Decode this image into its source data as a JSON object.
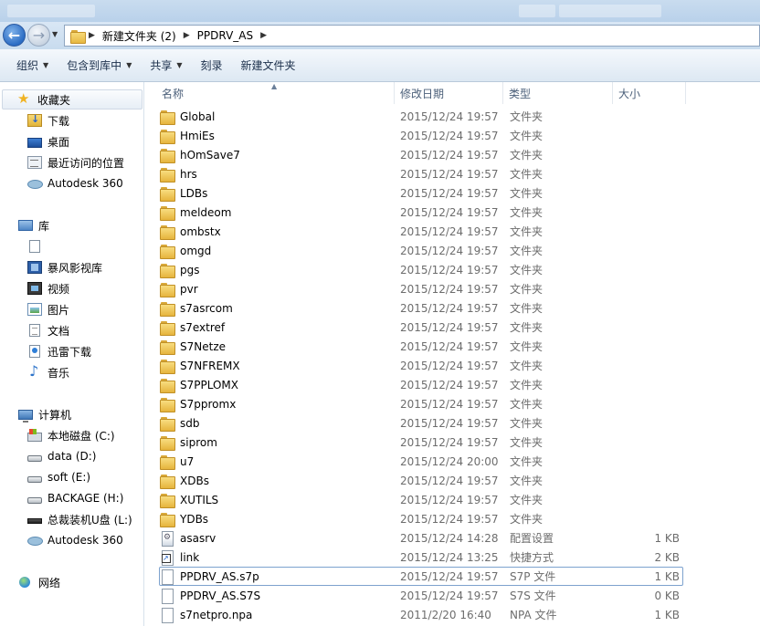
{
  "address": {
    "crumbs": [
      "新建文件夹 (2)",
      "PPDRV_AS"
    ]
  },
  "toolbar": {
    "items": [
      {
        "label": "组织",
        "dropdown": true
      },
      {
        "label": "包含到库中",
        "dropdown": true
      },
      {
        "label": "共享",
        "dropdown": true
      },
      {
        "label": "刻录",
        "dropdown": false
      },
      {
        "label": "新建文件夹",
        "dropdown": false
      }
    ]
  },
  "sidebar": {
    "favorites": {
      "label": "收藏夹",
      "items": [
        {
          "label": "下载",
          "icon": "download-folder-icon"
        },
        {
          "label": "桌面",
          "icon": "desktop-icon"
        },
        {
          "label": "最近访问的位置",
          "icon": "recent-places-icon"
        },
        {
          "label": "Autodesk 360",
          "icon": "autodesk-cloud-icon"
        }
      ]
    },
    "libraries": {
      "label": "库",
      "items": [
        {
          "label": "",
          "icon": "document-icon"
        },
        {
          "label": "暴风影视库",
          "icon": "media-library-icon"
        },
        {
          "label": "视频",
          "icon": "video-icon"
        },
        {
          "label": "图片",
          "icon": "pictures-icon"
        },
        {
          "label": "文档",
          "icon": "documents-icon"
        },
        {
          "label": "迅雷下载",
          "icon": "thunder-download-icon"
        },
        {
          "label": "音乐",
          "icon": "music-icon"
        }
      ]
    },
    "computer": {
      "label": "计算机",
      "items": [
        {
          "label": "本地磁盘 (C:)",
          "icon": "system-drive-icon"
        },
        {
          "label": "data (D:)",
          "icon": "drive-icon"
        },
        {
          "label": "soft (E:)",
          "icon": "drive-icon"
        },
        {
          "label": "BACKAGE (H:)",
          "icon": "drive-icon"
        },
        {
          "label": "总裁装机U盘 (L:)",
          "icon": "usb-drive-icon"
        },
        {
          "label": "Autodesk 360",
          "icon": "autodesk-cloud-icon"
        }
      ]
    },
    "network": {
      "label": "网络"
    }
  },
  "columns": {
    "name": "名称",
    "date": "修改日期",
    "type": "类型",
    "size": "大小"
  },
  "files": [
    {
      "name": "Global",
      "date": "2015/12/24 19:57",
      "type": "文件夹",
      "size": "",
      "icon": "folder"
    },
    {
      "name": "HmiEs",
      "date": "2015/12/24 19:57",
      "type": "文件夹",
      "size": "",
      "icon": "folder"
    },
    {
      "name": "hOmSave7",
      "date": "2015/12/24 19:57",
      "type": "文件夹",
      "size": "",
      "icon": "folder"
    },
    {
      "name": "hrs",
      "date": "2015/12/24 19:57",
      "type": "文件夹",
      "size": "",
      "icon": "folder"
    },
    {
      "name": "LDBs",
      "date": "2015/12/24 19:57",
      "type": "文件夹",
      "size": "",
      "icon": "folder"
    },
    {
      "name": "meldeom",
      "date": "2015/12/24 19:57",
      "type": "文件夹",
      "size": "",
      "icon": "folder"
    },
    {
      "name": "ombstx",
      "date": "2015/12/24 19:57",
      "type": "文件夹",
      "size": "",
      "icon": "folder"
    },
    {
      "name": "omgd",
      "date": "2015/12/24 19:57",
      "type": "文件夹",
      "size": "",
      "icon": "folder"
    },
    {
      "name": "pgs",
      "date": "2015/12/24 19:57",
      "type": "文件夹",
      "size": "",
      "icon": "folder"
    },
    {
      "name": "pvr",
      "date": "2015/12/24 19:57",
      "type": "文件夹",
      "size": "",
      "icon": "folder"
    },
    {
      "name": "s7asrcom",
      "date": "2015/12/24 19:57",
      "type": "文件夹",
      "size": "",
      "icon": "folder"
    },
    {
      "name": "s7extref",
      "date": "2015/12/24 19:57",
      "type": "文件夹",
      "size": "",
      "icon": "folder"
    },
    {
      "name": "S7Netze",
      "date": "2015/12/24 19:57",
      "type": "文件夹",
      "size": "",
      "icon": "folder"
    },
    {
      "name": "S7NFREMX",
      "date": "2015/12/24 19:57",
      "type": "文件夹",
      "size": "",
      "icon": "folder"
    },
    {
      "name": "S7PPLOMX",
      "date": "2015/12/24 19:57",
      "type": "文件夹",
      "size": "",
      "icon": "folder"
    },
    {
      "name": "S7ppromx",
      "date": "2015/12/24 19:57",
      "type": "文件夹",
      "size": "",
      "icon": "folder"
    },
    {
      "name": "sdb",
      "date": "2015/12/24 19:57",
      "type": "文件夹",
      "size": "",
      "icon": "folder"
    },
    {
      "name": "siprom",
      "date": "2015/12/24 19:57",
      "type": "文件夹",
      "size": "",
      "icon": "folder"
    },
    {
      "name": "u7",
      "date": "2015/12/24 20:00",
      "type": "文件夹",
      "size": "",
      "icon": "folder"
    },
    {
      "name": "XDBs",
      "date": "2015/12/24 19:57",
      "type": "文件夹",
      "size": "",
      "icon": "folder"
    },
    {
      "name": "XUTILS",
      "date": "2015/12/24 19:57",
      "type": "文件夹",
      "size": "",
      "icon": "folder"
    },
    {
      "name": "YDBs",
      "date": "2015/12/24 19:57",
      "type": "文件夹",
      "size": "",
      "icon": "folder"
    },
    {
      "name": "asasrv",
      "date": "2015/12/24 14:28",
      "type": "配置设置",
      "size": "1 KB",
      "icon": "ini"
    },
    {
      "name": "link",
      "date": "2015/12/24 13:25",
      "type": "快捷方式",
      "size": "2 KB",
      "icon": "link"
    },
    {
      "name": "PPDRV_AS.s7p",
      "date": "2015/12/24 19:57",
      "type": "S7P 文件",
      "size": "1 KB",
      "icon": "file",
      "selected": true
    },
    {
      "name": "PPDRV_AS.S7S",
      "date": "2015/12/24 19:57",
      "type": "S7S 文件",
      "size": "0 KB",
      "icon": "file"
    },
    {
      "name": "s7netpro.npa",
      "date": "2011/2/20 16:40",
      "type": "NPA 文件",
      "size": "1 KB",
      "icon": "file"
    }
  ]
}
